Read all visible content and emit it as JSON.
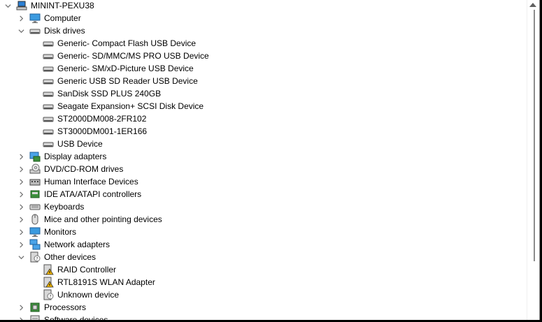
{
  "root": {
    "label": "MININT-PEXU38",
    "icon": "computer-root-icon"
  },
  "nodes": [
    {
      "label": "Computer",
      "icon": "monitor-icon",
      "expanded": false
    },
    {
      "label": "Disk drives",
      "icon": "drive-icon",
      "expanded": true,
      "children": [
        "Generic- Compact Flash USB Device",
        "Generic- SD/MMC/MS PRO USB Device",
        "Generic- SM/xD-Picture USB Device",
        "Generic USB SD Reader USB Device",
        "SanDisk SSD PLUS 240GB",
        "Seagate Expansion+ SCSI Disk Device",
        "ST2000DM008-2FR102",
        "ST3000DM001-1ER166",
        "USB Device"
      ]
    },
    {
      "label": "Display adapters",
      "icon": "display-adapter-icon",
      "expanded": false
    },
    {
      "label": "DVD/CD-ROM drives",
      "icon": "dvd-icon",
      "expanded": false
    },
    {
      "label": "Human Interface Devices",
      "icon": "hid-icon",
      "expanded": false
    },
    {
      "label": "IDE ATA/ATAPI controllers",
      "icon": "ide-controller-icon",
      "expanded": false
    },
    {
      "label": "Keyboards",
      "icon": "keyboard-icon",
      "expanded": false
    },
    {
      "label": "Mice and other pointing devices",
      "icon": "mouse-icon",
      "expanded": false
    },
    {
      "label": "Monitors",
      "icon": "monitor-icon",
      "expanded": false
    },
    {
      "label": "Network adapters",
      "icon": "network-icon",
      "expanded": false
    },
    {
      "label": "Other devices",
      "icon": "unknown-device-icon",
      "expanded": true,
      "children": [
        {
          "label": "RAID Controller",
          "icon": "warning-device-icon"
        },
        {
          "label": "RTL8191S WLAN Adapter",
          "icon": "warning-device-icon"
        },
        {
          "label": "Unknown device",
          "icon": "unknown-device-icon"
        }
      ]
    },
    {
      "label": "Processors",
      "icon": "processor-icon",
      "expanded": false
    },
    {
      "label": "Software devices",
      "icon": "software-device-icon",
      "expanded": false
    }
  ],
  "colors": {
    "text": "#000000",
    "chevron": "#6b6b6b",
    "warning": "#f0b400"
  }
}
